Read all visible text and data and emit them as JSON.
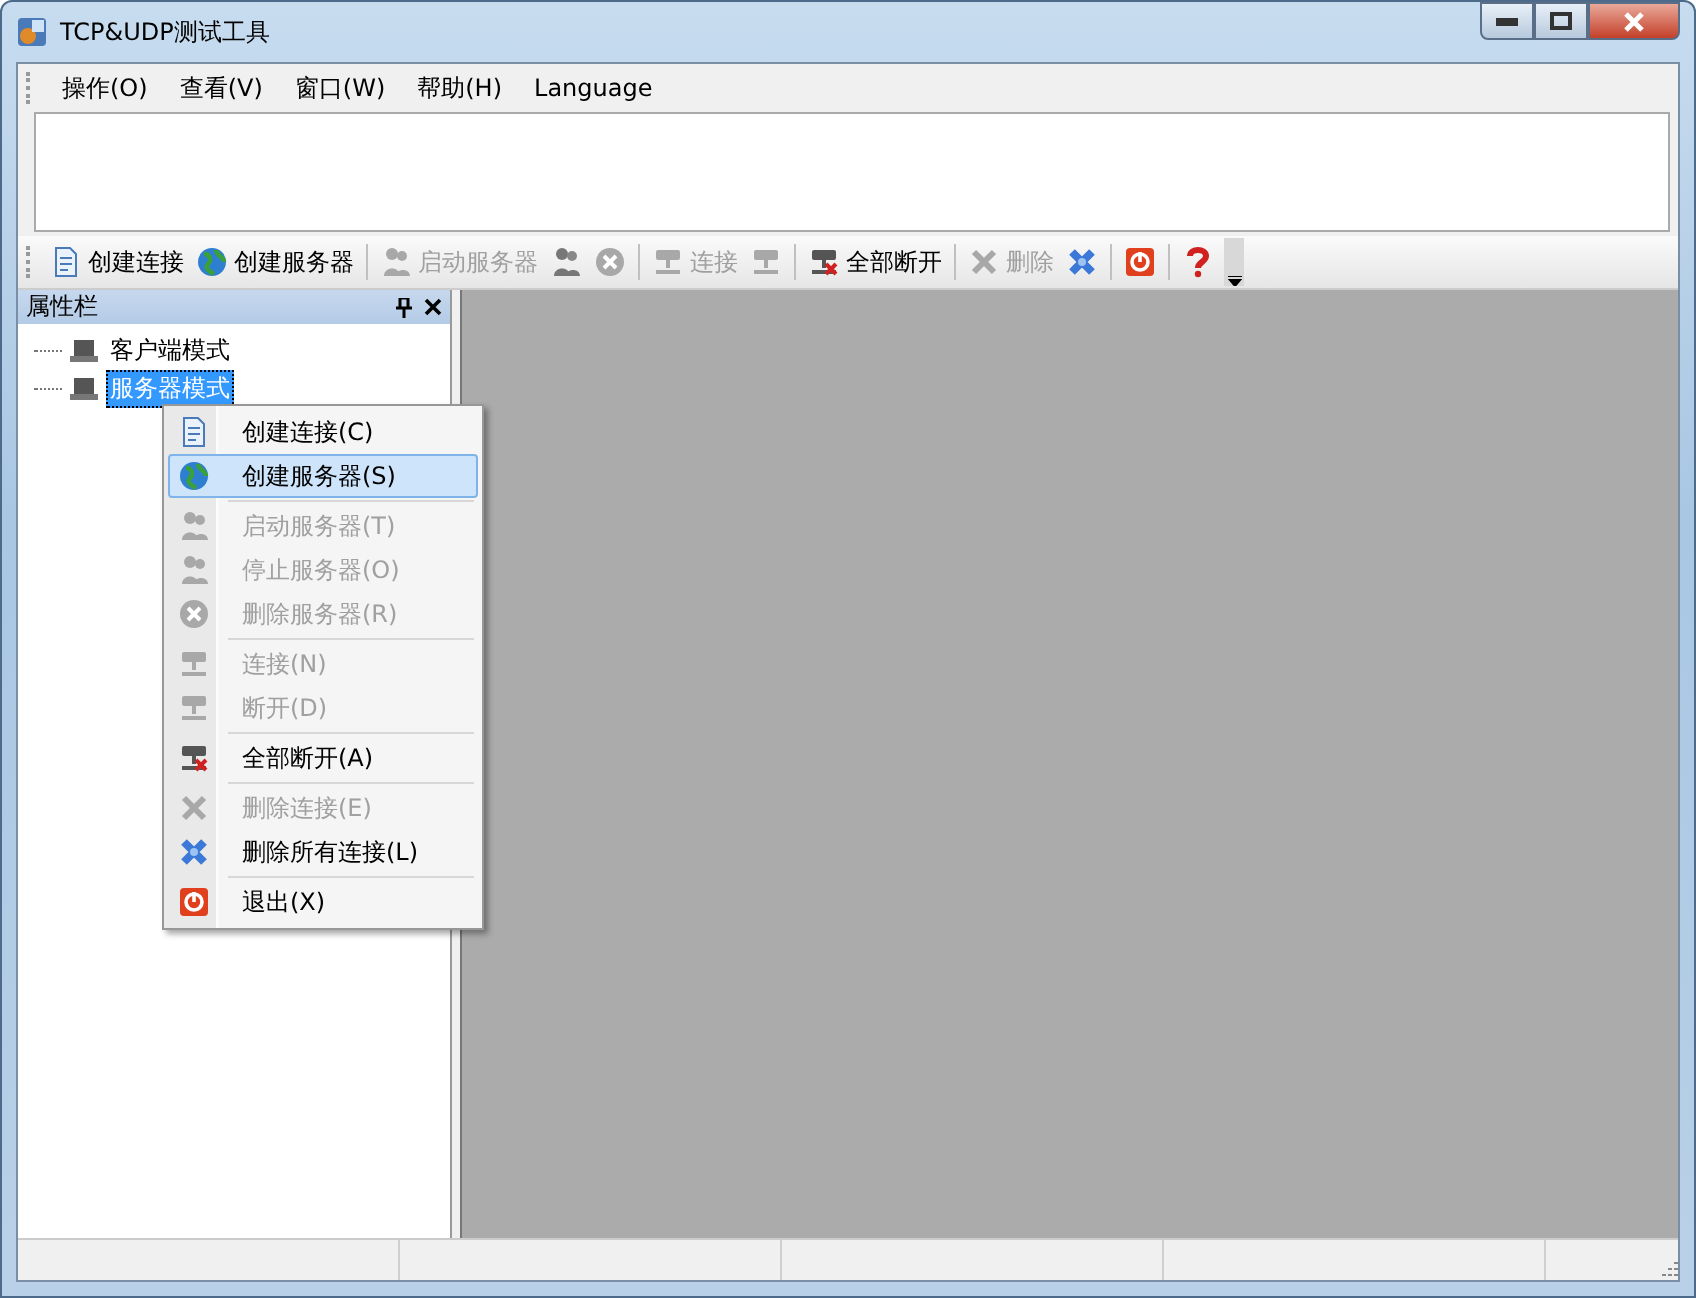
{
  "window": {
    "title": "TCP&UDP测试工具"
  },
  "menu_bar": [
    "操作(O)",
    "查看(V)",
    "窗口(W)",
    "帮助(H)",
    "Language"
  ],
  "toolbar": {
    "groups": [
      [
        {
          "label": "创建连接",
          "disabled": false
        },
        {
          "label": "创建服务器",
          "disabled": false
        }
      ],
      [
        {
          "label": "启动服务器",
          "disabled": true
        },
        {
          "disabled": false
        },
        {
          "disabled": true
        }
      ],
      [
        {
          "label": "连接",
          "disabled": true
        },
        {
          "disabled": true
        }
      ],
      [
        {
          "label": "全部断开",
          "disabled": false
        }
      ],
      [
        {
          "label": "删除",
          "disabled": true
        },
        {
          "disabled": false
        }
      ],
      [
        {
          "disabled": false
        }
      ],
      [
        {
          "disabled": false
        }
      ]
    ]
  },
  "properties_panel": {
    "title": "属性栏",
    "tree": [
      {
        "label": "客户端模式",
        "selected": false
      },
      {
        "label": "服务器模式",
        "selected": true
      }
    ]
  },
  "context_menu": {
    "groups": [
      [
        {
          "label": "创建连接(C)",
          "disabled": false,
          "selected": false
        },
        {
          "label": "创建服务器(S)",
          "disabled": false,
          "selected": true
        }
      ],
      [
        {
          "label": "启动服务器(T)",
          "disabled": true,
          "selected": false
        },
        {
          "label": "停止服务器(O)",
          "disabled": true,
          "selected": false
        },
        {
          "label": "删除服务器(R)",
          "disabled": true,
          "selected": false
        }
      ],
      [
        {
          "label": "连接(N)",
          "disabled": true,
          "selected": false
        },
        {
          "label": "断开(D)",
          "disabled": true,
          "selected": false
        }
      ],
      [
        {
          "label": "全部断开(A)",
          "disabled": false,
          "selected": false
        }
      ],
      [
        {
          "label": "删除连接(E)",
          "disabled": true,
          "selected": false
        },
        {
          "label": "删除所有连接(L)",
          "disabled": false,
          "selected": false
        }
      ],
      [
        {
          "label": "退出(X)",
          "disabled": false,
          "selected": false
        }
      ]
    ]
  }
}
